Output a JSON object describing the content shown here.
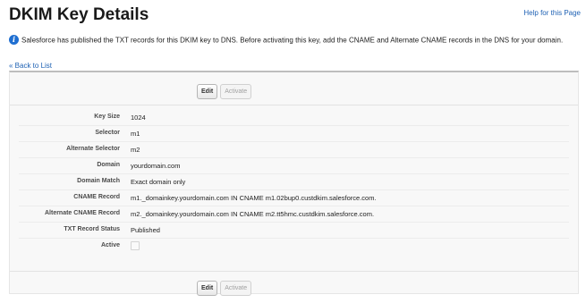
{
  "header": {
    "title": "DKIM Key Details",
    "help_link": "Help for this Page"
  },
  "info": {
    "icon": "info-icon",
    "message": "Salesforce has published the TXT records for this DKIM key to DNS. Before activating this key, add the CNAME and Alternate CNAME records in the DNS for your domain."
  },
  "nav": {
    "back_link": "« Back to List"
  },
  "buttons": {
    "edit": "Edit",
    "activate": "Activate"
  },
  "fields": {
    "key_size": {
      "label": "Key Size",
      "value": "1024"
    },
    "selector": {
      "label": "Selector",
      "value": "m1"
    },
    "alternate_selector": {
      "label": "Alternate Selector",
      "value": "m2"
    },
    "domain": {
      "label": "Domain",
      "value": "yourdomain.com"
    },
    "domain_match": {
      "label": "Domain Match",
      "value": "Exact domain only"
    },
    "cname_record": {
      "label": "CNAME Record",
      "value": "m1._domainkey.yourdomain.com IN CNAME m1.02bup0.custdkim.salesforce.com."
    },
    "alt_cname_record": {
      "label": "Alternate CNAME Record",
      "value": "m2._domainkey.yourdomain.com IN CNAME m2.tt5hmc.custdkim.salesforce.com."
    },
    "txt_record_status": {
      "label": "TXT Record Status",
      "value": "Published"
    },
    "active": {
      "label": "Active",
      "checked": false
    }
  },
  "colors": {
    "link": "#1f62b4",
    "info_icon": "#1f6fd1"
  }
}
